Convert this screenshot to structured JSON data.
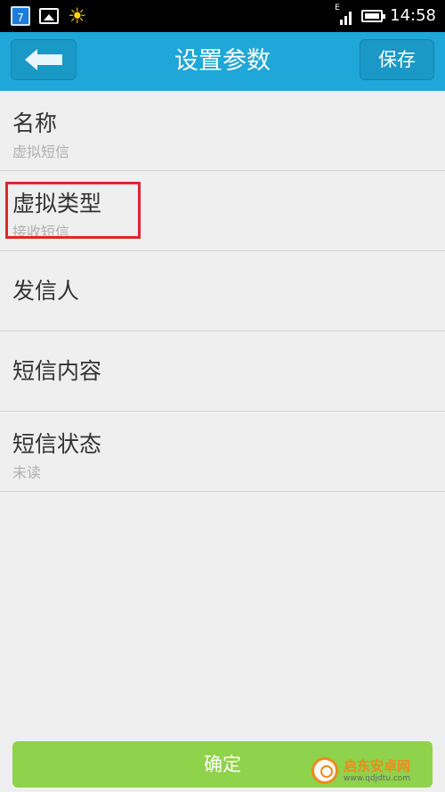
{
  "status_bar": {
    "calendar_day": "7",
    "network": "E",
    "time": "14:58",
    "icons": [
      "calendar-icon",
      "image-icon",
      "sun-icon",
      "signal-icon",
      "battery-icon"
    ]
  },
  "header": {
    "title": "设置参数",
    "save_label": "保存",
    "back_icon": "back-arrow-icon"
  },
  "list": {
    "items": [
      {
        "label": "名称",
        "value": "虚拟短信"
      },
      {
        "label": "虚拟类型",
        "value": "接收短信"
      },
      {
        "label": "发信人",
        "value": ""
      },
      {
        "label": "短信内容",
        "value": ""
      },
      {
        "label": "短信状态",
        "value": "未读"
      }
    ]
  },
  "confirm_label": "确定",
  "watermark": {
    "name": "启东安卓网",
    "url": "www.qdjdtu.com"
  },
  "colors": {
    "header": "#1ea7d8",
    "confirm": "#8fd24b",
    "highlight": "#e0262d"
  }
}
